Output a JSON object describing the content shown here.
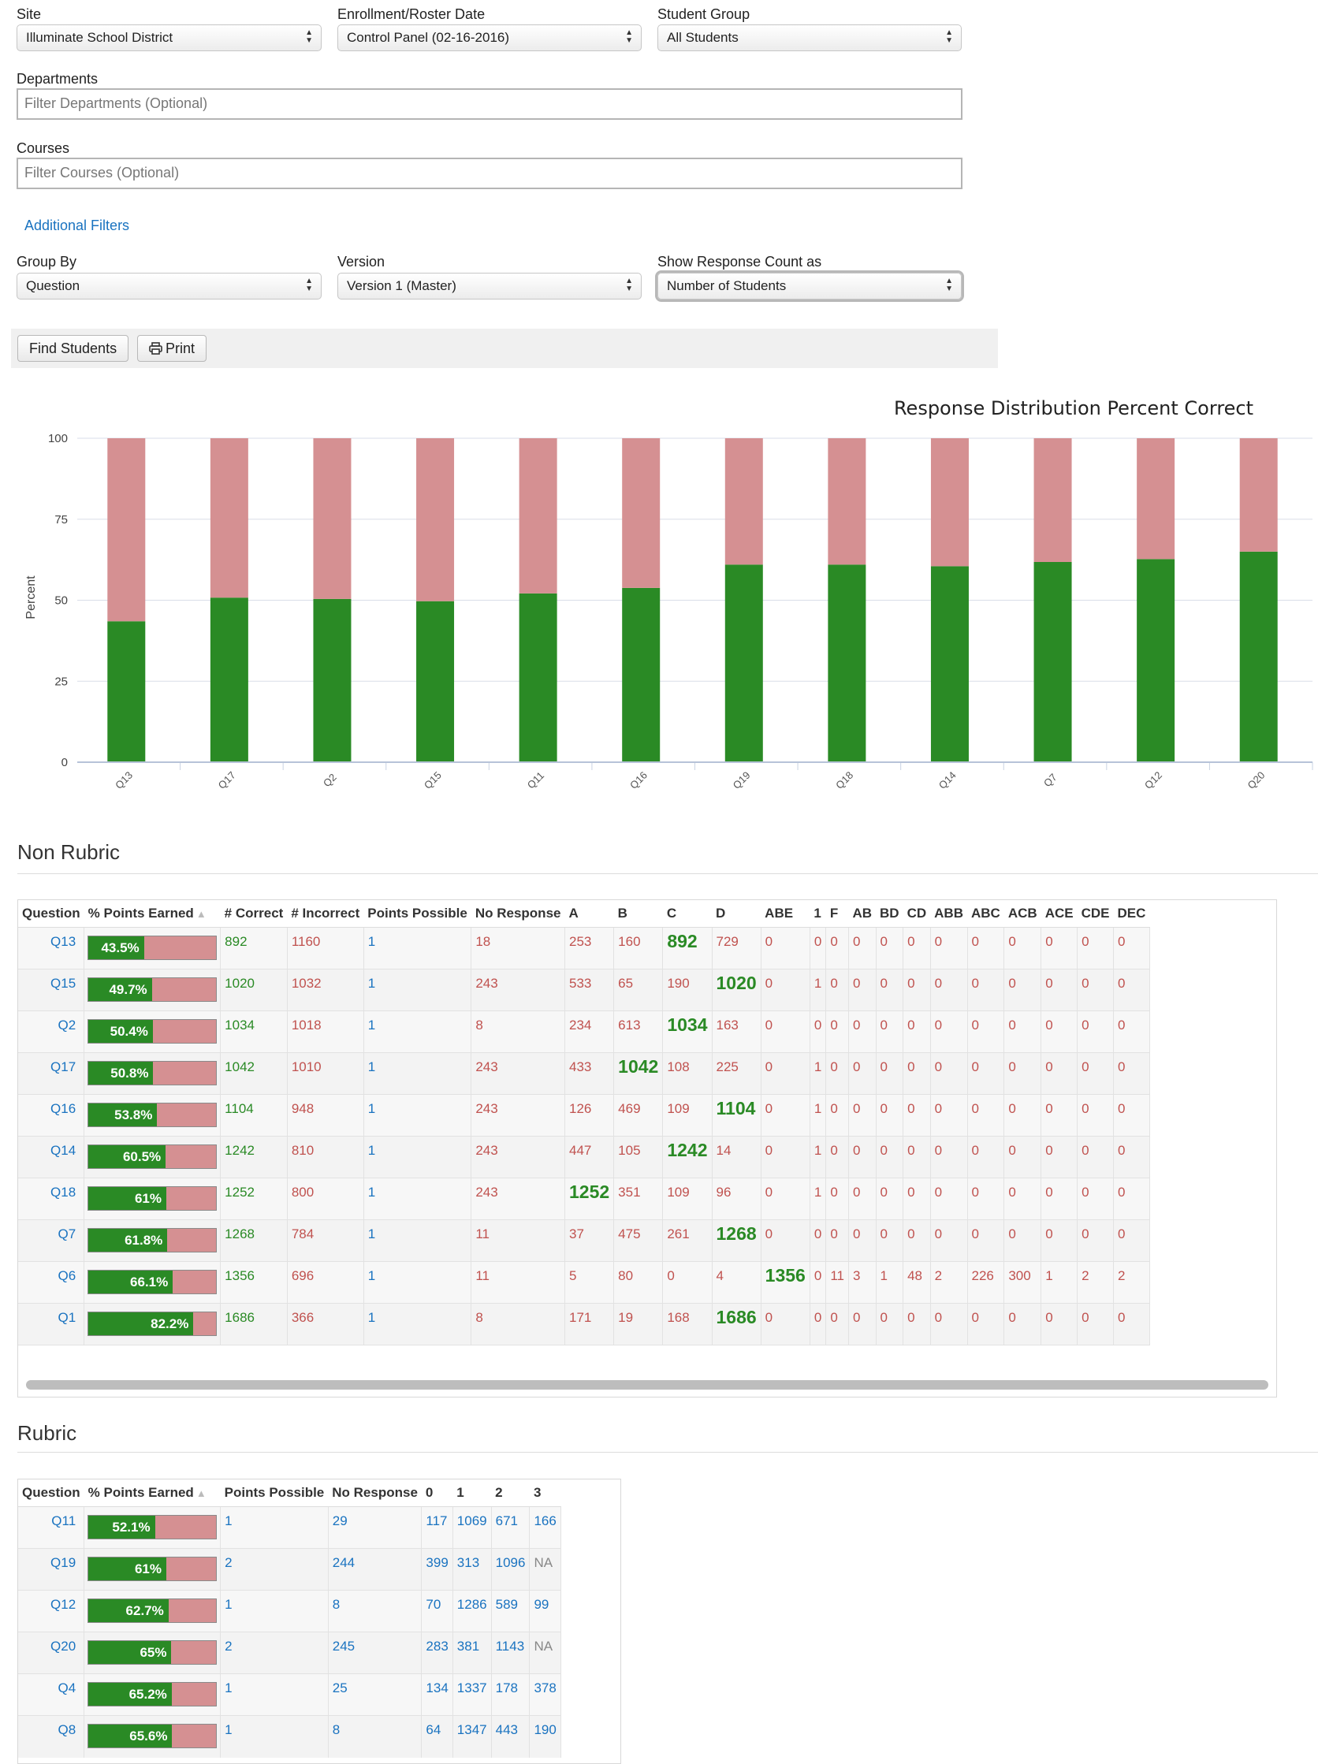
{
  "filters": {
    "site": {
      "label": "Site",
      "value": "Illuminate School District"
    },
    "enrollment": {
      "label": "Enrollment/Roster Date",
      "value": "Control Panel (02-16-2016)"
    },
    "student_group": {
      "label": "Student Group",
      "value": "All Students"
    },
    "departments": {
      "label": "Departments",
      "placeholder": "Filter Departments (Optional)"
    },
    "courses": {
      "label": "Courses",
      "placeholder": "Filter Courses (Optional)"
    },
    "additional_filters": "Additional Filters",
    "group_by": {
      "label": "Group By",
      "value": "Question"
    },
    "version": {
      "label": "Version",
      "value": "Version 1 (Master)"
    },
    "response_count": {
      "label": "Show Response Count as",
      "value": "Number of Students"
    }
  },
  "toolbar": {
    "find_students": "Find Students",
    "print": "Print"
  },
  "colors": {
    "correct": "#2a8a25",
    "incorrect": "#d59092",
    "link": "#1a73c0",
    "incorrect_text": "#c0524f"
  },
  "chart_data": {
    "type": "bar",
    "stacked": true,
    "title": "Response Distribution Percent Correct",
    "ylabel": "Percent",
    "xlabel": "",
    "ylim": [
      0,
      100
    ],
    "yticks": [
      0,
      25,
      50,
      75,
      100
    ],
    "grid": true,
    "categories": [
      "Q13",
      "Q17",
      "Q2",
      "Q15",
      "Q11",
      "Q16",
      "Q19",
      "Q18",
      "Q14",
      "Q7",
      "Q12",
      "Q20"
    ],
    "series": [
      {
        "color": "#2a8a25",
        "values": [
          43.5,
          50.8,
          50.4,
          49.7,
          52.1,
          53.8,
          61,
          61,
          60.5,
          61.8,
          62.7,
          65
        ]
      },
      {
        "color": "#d59092",
        "values": [
          56.5,
          49.2,
          49.6,
          50.3,
          47.9,
          46.2,
          39,
          39,
          39.5,
          38.2,
          37.3,
          35
        ]
      }
    ]
  },
  "non_rubric": {
    "title": "Non Rubric",
    "headers": [
      "Question",
      "% Points Earned",
      "# Correct",
      "# Incorrect",
      "Points Possible",
      "No Response",
      "A",
      "B",
      "C",
      "D",
      "ABE",
      "1",
      "F",
      "AB",
      "BD",
      "CD",
      "ABB",
      "ABC",
      "ACB",
      "ACE",
      "CDE",
      "DEC"
    ],
    "sort_indicator": "▲",
    "rows": [
      {
        "q": "Q13",
        "pct": 43.5,
        "pct_text": "43.5%",
        "correct": "892",
        "incorrect": "1160",
        "pp": "1",
        "nr": "18",
        "resp": [
          "253",
          "160",
          "892",
          "729",
          "0",
          "0",
          "0",
          "0",
          "0",
          "0",
          "0",
          "0",
          "0",
          "0",
          "0",
          "0"
        ],
        "key": 2
      },
      {
        "q": "Q15",
        "pct": 49.7,
        "pct_text": "49.7%",
        "correct": "1020",
        "incorrect": "1032",
        "pp": "1",
        "nr": "243",
        "resp": [
          "533",
          "65",
          "190",
          "1020",
          "0",
          "1",
          "0",
          "0",
          "0",
          "0",
          "0",
          "0",
          "0",
          "0",
          "0",
          "0"
        ],
        "key": 3
      },
      {
        "q": "Q2",
        "pct": 50.4,
        "pct_text": "50.4%",
        "correct": "1034",
        "incorrect": "1018",
        "pp": "1",
        "nr": "8",
        "resp": [
          "234",
          "613",
          "1034",
          "163",
          "0",
          "0",
          "0",
          "0",
          "0",
          "0",
          "0",
          "0",
          "0",
          "0",
          "0",
          "0"
        ],
        "key": 2
      },
      {
        "q": "Q17",
        "pct": 50.8,
        "pct_text": "50.8%",
        "correct": "1042",
        "incorrect": "1010",
        "pp": "1",
        "nr": "243",
        "resp": [
          "433",
          "1042",
          "108",
          "225",
          "0",
          "1",
          "0",
          "0",
          "0",
          "0",
          "0",
          "0",
          "0",
          "0",
          "0",
          "0"
        ],
        "key": 1
      },
      {
        "q": "Q16",
        "pct": 53.8,
        "pct_text": "53.8%",
        "correct": "1104",
        "incorrect": "948",
        "pp": "1",
        "nr": "243",
        "resp": [
          "126",
          "469",
          "109",
          "1104",
          "0",
          "1",
          "0",
          "0",
          "0",
          "0",
          "0",
          "0",
          "0",
          "0",
          "0",
          "0"
        ],
        "key": 3
      },
      {
        "q": "Q14",
        "pct": 60.5,
        "pct_text": "60.5%",
        "correct": "1242",
        "incorrect": "810",
        "pp": "1",
        "nr": "243",
        "resp": [
          "447",
          "105",
          "1242",
          "14",
          "0",
          "1",
          "0",
          "0",
          "0",
          "0",
          "0",
          "0",
          "0",
          "0",
          "0",
          "0"
        ],
        "key": 2
      },
      {
        "q": "Q18",
        "pct": 61,
        "pct_text": "61%",
        "correct": "1252",
        "incorrect": "800",
        "pp": "1",
        "nr": "243",
        "resp": [
          "1252",
          "351",
          "109",
          "96",
          "0",
          "1",
          "0",
          "0",
          "0",
          "0",
          "0",
          "0",
          "0",
          "0",
          "0",
          "0"
        ],
        "key": 0
      },
      {
        "q": "Q7",
        "pct": 61.8,
        "pct_text": "61.8%",
        "correct": "1268",
        "incorrect": "784",
        "pp": "1",
        "nr": "11",
        "resp": [
          "37",
          "475",
          "261",
          "1268",
          "0",
          "0",
          "0",
          "0",
          "0",
          "0",
          "0",
          "0",
          "0",
          "0",
          "0",
          "0"
        ],
        "key": 3
      },
      {
        "q": "Q6",
        "pct": 66.1,
        "pct_text": "66.1%",
        "correct": "1356",
        "incorrect": "696",
        "pp": "1",
        "nr": "11",
        "resp": [
          "5",
          "80",
          "0",
          "4",
          "1356",
          "0",
          "11",
          "3",
          "1",
          "48",
          "2",
          "226",
          "300",
          "1",
          "2",
          "2"
        ],
        "key": 4
      },
      {
        "q": "Q1",
        "pct": 82.2,
        "pct_text": "82.2%",
        "correct": "1686",
        "incorrect": "366",
        "pp": "1",
        "nr": "8",
        "resp": [
          "171",
          "19",
          "168",
          "1686",
          "0",
          "0",
          "0",
          "0",
          "0",
          "0",
          "0",
          "0",
          "0",
          "0",
          "0",
          "0"
        ],
        "key": 3
      }
    ]
  },
  "rubric": {
    "title": "Rubric",
    "headers": [
      "Question",
      "% Points Earned",
      "Points Possible",
      "No Response",
      "0",
      "1",
      "2",
      "3"
    ],
    "sort_indicator": "▲",
    "rows": [
      {
        "q": "Q11",
        "pct": 52.1,
        "pct_text": "52.1%",
        "pp": "1",
        "nr": "29",
        "scores": [
          "117",
          "1069",
          "671",
          "166"
        ]
      },
      {
        "q": "Q19",
        "pct": 61,
        "pct_text": "61%",
        "pp": "2",
        "nr": "244",
        "scores": [
          "399",
          "313",
          "1096",
          "NA"
        ]
      },
      {
        "q": "Q12",
        "pct": 62.7,
        "pct_text": "62.7%",
        "pp": "1",
        "nr": "8",
        "scores": [
          "70",
          "1286",
          "589",
          "99"
        ]
      },
      {
        "q": "Q20",
        "pct": 65,
        "pct_text": "65%",
        "pp": "2",
        "nr": "245",
        "scores": [
          "283",
          "381",
          "1143",
          "NA"
        ]
      },
      {
        "q": "Q4",
        "pct": 65.2,
        "pct_text": "65.2%",
        "pp": "1",
        "nr": "25",
        "scores": [
          "134",
          "1337",
          "178",
          "378"
        ]
      },
      {
        "q": "Q8",
        "pct": 65.6,
        "pct_text": "65.6%",
        "pp": "1",
        "nr": "8",
        "scores": [
          "64",
          "1347",
          "443",
          "190"
        ]
      }
    ]
  }
}
